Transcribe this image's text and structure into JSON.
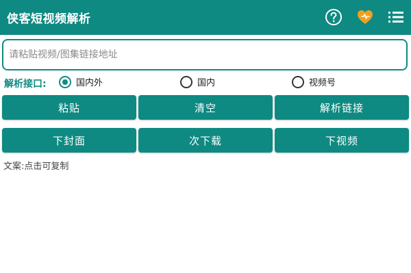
{
  "app": {
    "title": "侠客短视频解析"
  },
  "actions": {
    "help_icon": "help-circle-icon",
    "favorite_icon": "heart-icon",
    "menu_icon": "list-menu-icon"
  },
  "input": {
    "value": "",
    "placeholder": "请粘贴视频/图集链接地址"
  },
  "api": {
    "label": "解析接口:",
    "options": [
      {
        "label": "国内外",
        "checked": true
      },
      {
        "label": "国内",
        "checked": false
      },
      {
        "label": "视频号",
        "checked": false
      }
    ]
  },
  "buttons_row1": {
    "paste": "粘贴",
    "clear": "清空",
    "parse": "解析链接"
  },
  "buttons_row2": {
    "cover": "下封面",
    "download": "次下载",
    "video": "下视频"
  },
  "copy_hint": "文案:点击可复制",
  "colors": {
    "primary": "#0e8a82",
    "heart": "#f0a020"
  }
}
